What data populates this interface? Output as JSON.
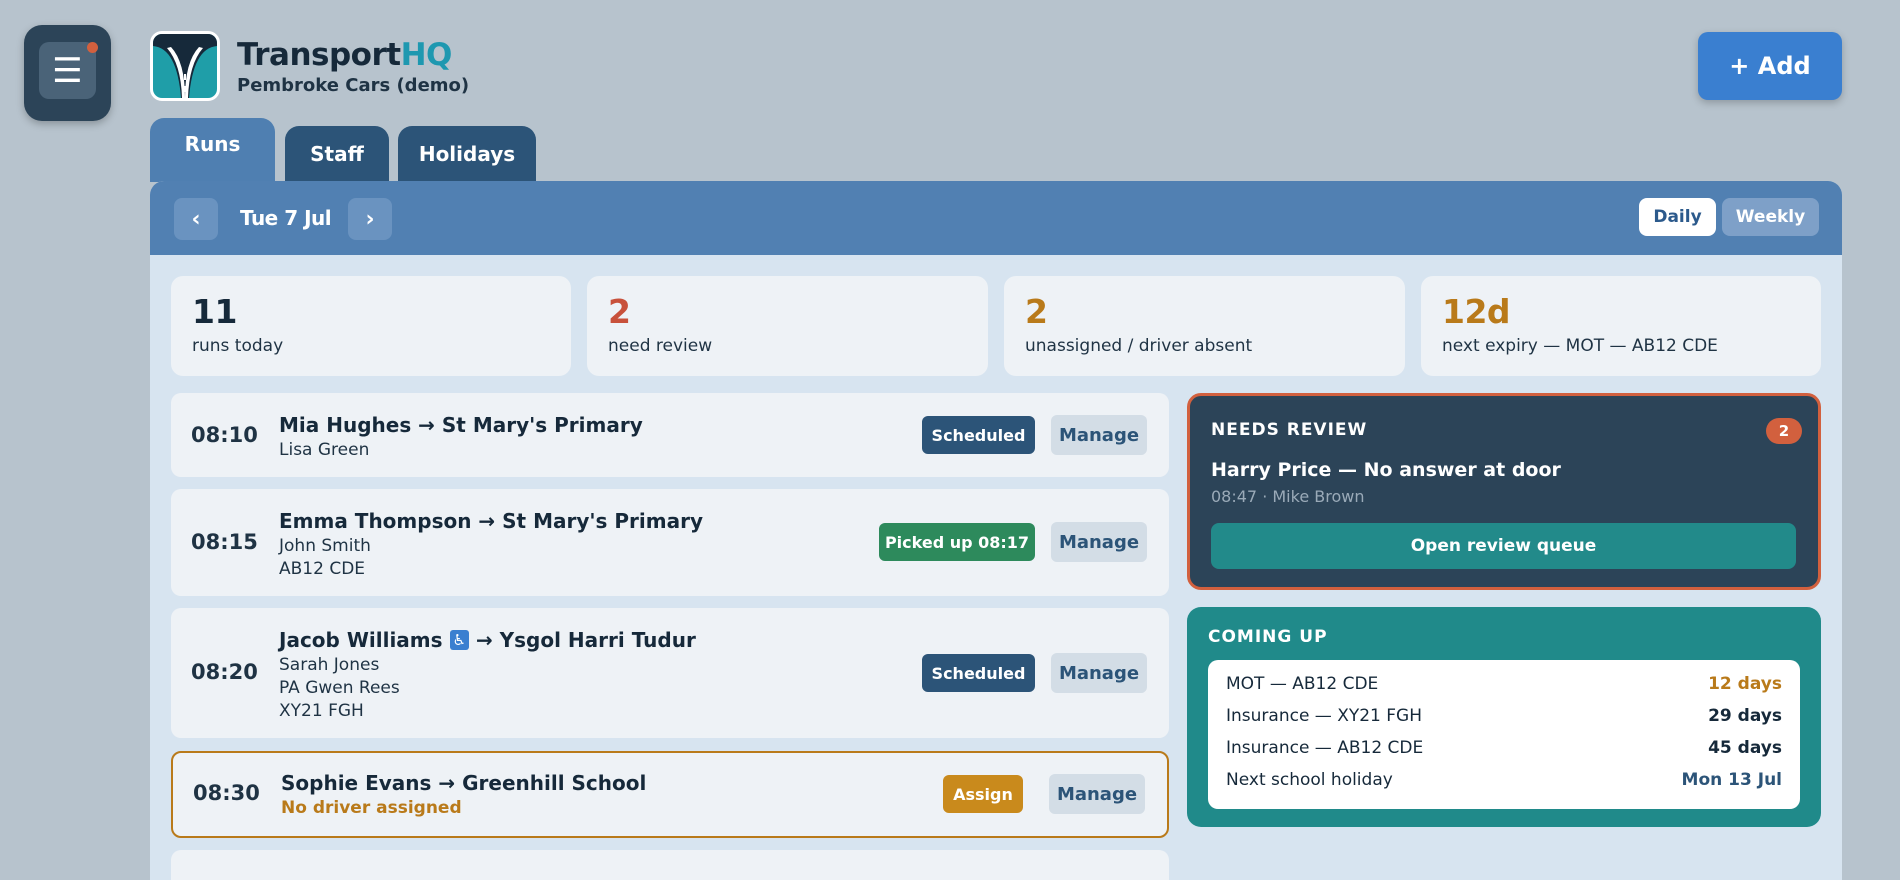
{
  "header": {
    "brand_name": "Transport",
    "brand_accent": "HQ",
    "org_name": "Pembroke Cars (demo)",
    "add_label": "+ Add",
    "menu_icon": "☰"
  },
  "tabs": [
    {
      "label": "Runs",
      "active": true
    },
    {
      "label": "Staff",
      "active": false
    },
    {
      "label": "Holidays",
      "active": false
    }
  ],
  "toolbar": {
    "prev": "‹",
    "next": "›",
    "date": "Tue 7 Jul",
    "view_daily": "Daily",
    "view_weekly": "Weekly",
    "selected_view": "Daily"
  },
  "stats": [
    {
      "value": "11",
      "label": "runs today",
      "color": "#16293a"
    },
    {
      "value": "2",
      "label": "need review",
      "color": "#c8513b"
    },
    {
      "value": "2",
      "label": "unassigned / driver absent",
      "color": "#b97a1a"
    },
    {
      "value": "12d",
      "label": "next expiry — MOT — AB12 CDE",
      "color": "#b97a1a"
    }
  ],
  "runs": [
    {
      "time": "08:10",
      "title": "Mia Hughes → St Mary's Primary",
      "lines": [
        "Lisa Green"
      ],
      "status": "Scheduled",
      "action": "Manage"
    },
    {
      "time": "08:15",
      "title": "Emma Thompson → St Mary's Primary",
      "lines": [
        "John Smith",
        "AB12 CDE"
      ],
      "status": "Picked up 08:17",
      "action": "Manage"
    },
    {
      "time": "08:20",
      "title_pre": "Jacob Williams",
      "title_icon": "♿",
      "title_post": "→ Ysgol Harri Tudur",
      "lines": [
        "Sarah Jones",
        "PA Gwen Rees",
        "XY21 FGH"
      ],
      "status": "Scheduled",
      "action": "Manage"
    },
    {
      "time": "08:30",
      "title": "Sophie Evans → Greenhill School",
      "warning": "No driver assigned",
      "status": "Assign",
      "action": "Manage"
    }
  ],
  "review": {
    "heading": "NEEDS REVIEW",
    "count": "2",
    "item_title": "Harry Price — No answer at door",
    "item_meta": "08:47 · Mike Brown",
    "button": "Open review queue"
  },
  "upcoming": {
    "heading": "COMING UP",
    "items": [
      {
        "label": "MOT — AB12 CDE",
        "value": "12 days"
      },
      {
        "label": "Insurance — XY21 FGH",
        "value": "29 days"
      },
      {
        "label": "Insurance — AB12 CDE",
        "value": "45 days"
      },
      {
        "label": "Next school holiday",
        "value": "Mon 13 Jul"
      }
    ]
  },
  "colors": {
    "background": "#b7c3cd",
    "accent": "#5180b2",
    "review_border": "#d2603e",
    "upcoming_bg": "#208a8a"
  }
}
